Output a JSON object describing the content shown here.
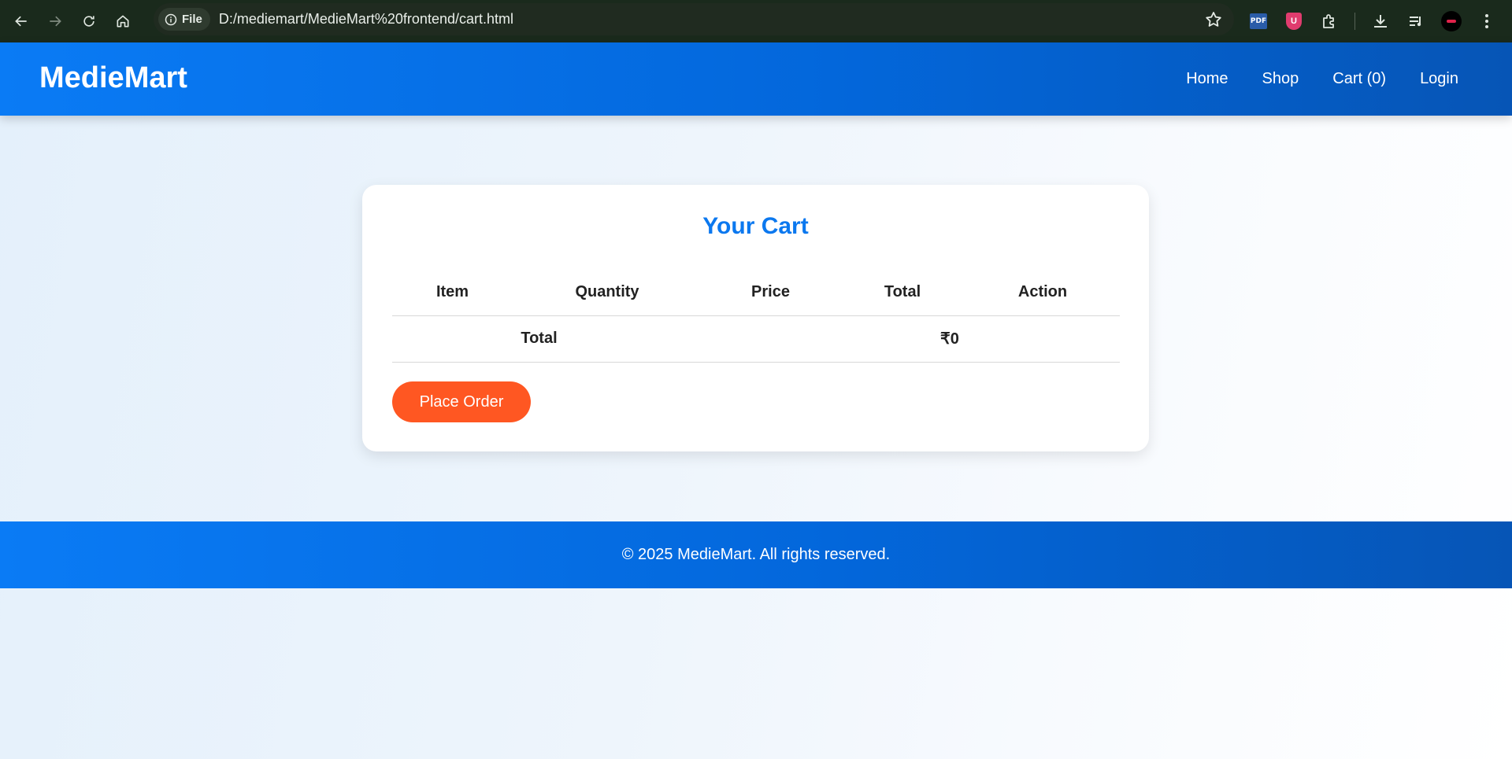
{
  "browser": {
    "chip_label": "File",
    "url": "D:/mediemart/MedieMart%20frontend/cart.html",
    "pdf_ext_label": "PDF",
    "shield_ext_label": "U"
  },
  "header": {
    "logo": "MedieMart",
    "nav": [
      {
        "label": "Home"
      },
      {
        "label": "Shop"
      },
      {
        "label": "Cart (0)"
      },
      {
        "label": "Login"
      }
    ]
  },
  "cart": {
    "title": "Your Cart",
    "columns": [
      "Item",
      "Quantity",
      "Price",
      "Total",
      "Action"
    ],
    "total_label": "Total",
    "total_value": "₹0",
    "place_order_label": "Place Order"
  },
  "footer": {
    "text": "© 2025 MedieMart. All rights reserved."
  },
  "colors": {
    "brand_blue": "#0a7bf5",
    "accent_orange": "#ff5722",
    "title_blue": "#0b78ef"
  }
}
